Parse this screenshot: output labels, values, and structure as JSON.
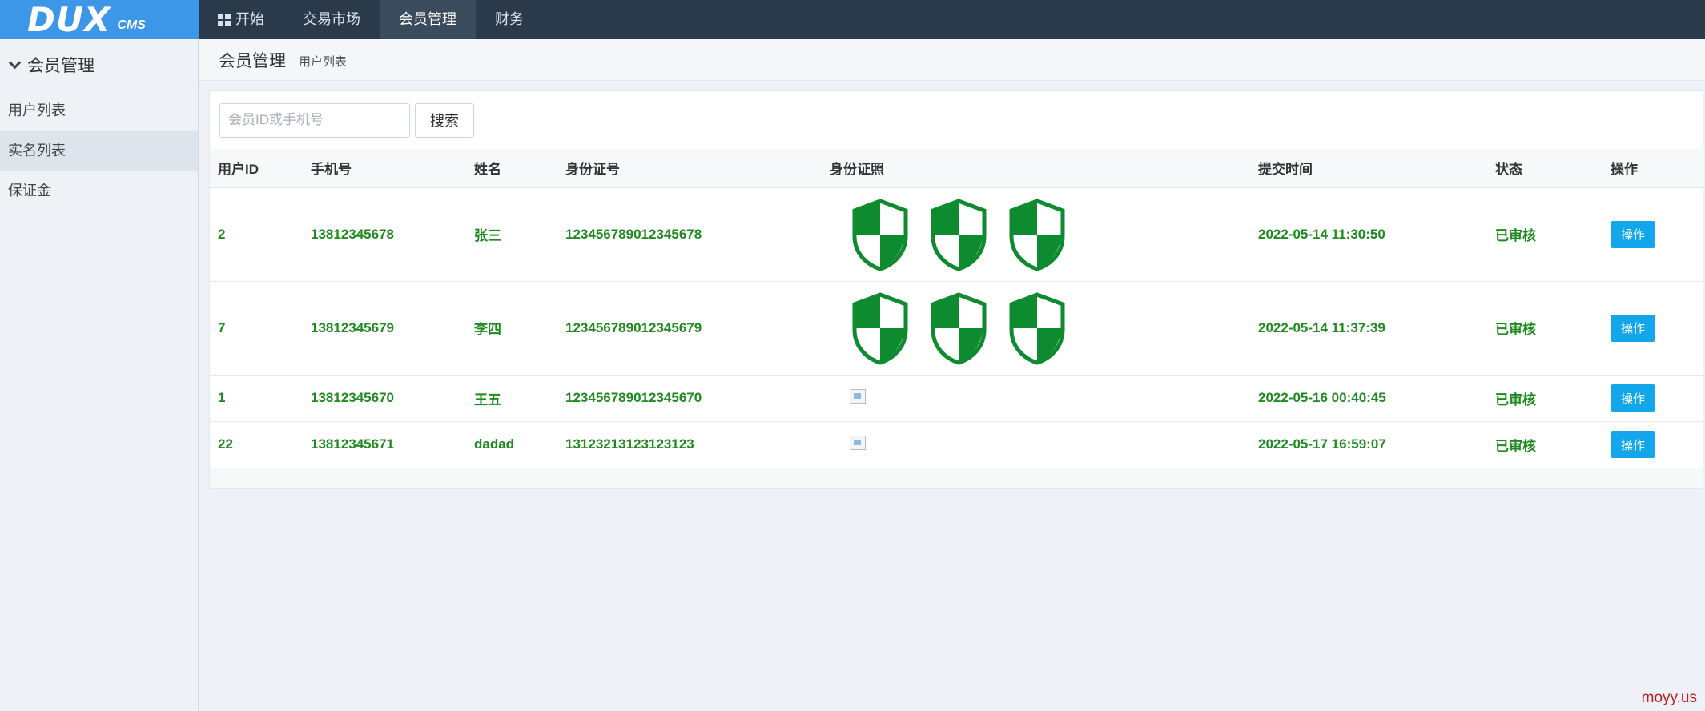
{
  "header": {
    "logo_main": "DUX",
    "logo_sub": "CMS",
    "nav": [
      {
        "label": "开始",
        "icon": "windows-icon"
      },
      {
        "label": "交易市场"
      },
      {
        "label": "会员管理"
      },
      {
        "label": "财务"
      }
    ]
  },
  "sidebar": {
    "title": "会员管理",
    "items": [
      {
        "label": "用户列表"
      },
      {
        "label": "实名列表"
      },
      {
        "label": "保证金"
      }
    ]
  },
  "breadcrumb": {
    "title": "会员管理",
    "sub": "用户列表"
  },
  "search": {
    "placeholder": "会员ID或手机号",
    "button": "搜索"
  },
  "table": {
    "headers": [
      "用户ID",
      "手机号",
      "姓名",
      "身份证号",
      "身份证照",
      "提交时间",
      "状态",
      "操作"
    ],
    "rows": [
      {
        "id": "2",
        "phone": "13812345678",
        "name": "张三",
        "idcard": "123456789012345678",
        "submitted": "2022-05-14 11:30:50",
        "status": "已审核",
        "action": "操作"
      },
      {
        "id": "7",
        "phone": "13812345679",
        "name": "李四",
        "idcard": "123456789012345679",
        "submitted": "2022-05-14 11:37:39",
        "status": "已审核",
        "action": "操作"
      },
      {
        "id": "1",
        "phone": "13812345670",
        "name": "王五",
        "idcard": "123456789012345670",
        "submitted": "2022-05-16 00:40:45",
        "status": "已审核",
        "action": "操作"
      },
      {
        "id": "22",
        "phone": "13812345671",
        "name": "dadad",
        "idcard": "13123213123123123",
        "submitted": "2022-05-17 16:59:07",
        "status": "已审核",
        "action": "操作"
      }
    ]
  },
  "colors": {
    "accent": "#13a6ea",
    "success": "#1f8a1f",
    "topbar": "#2b3a4a",
    "logo_bg": "#3d97e8"
  },
  "watermark": "moyy.us"
}
